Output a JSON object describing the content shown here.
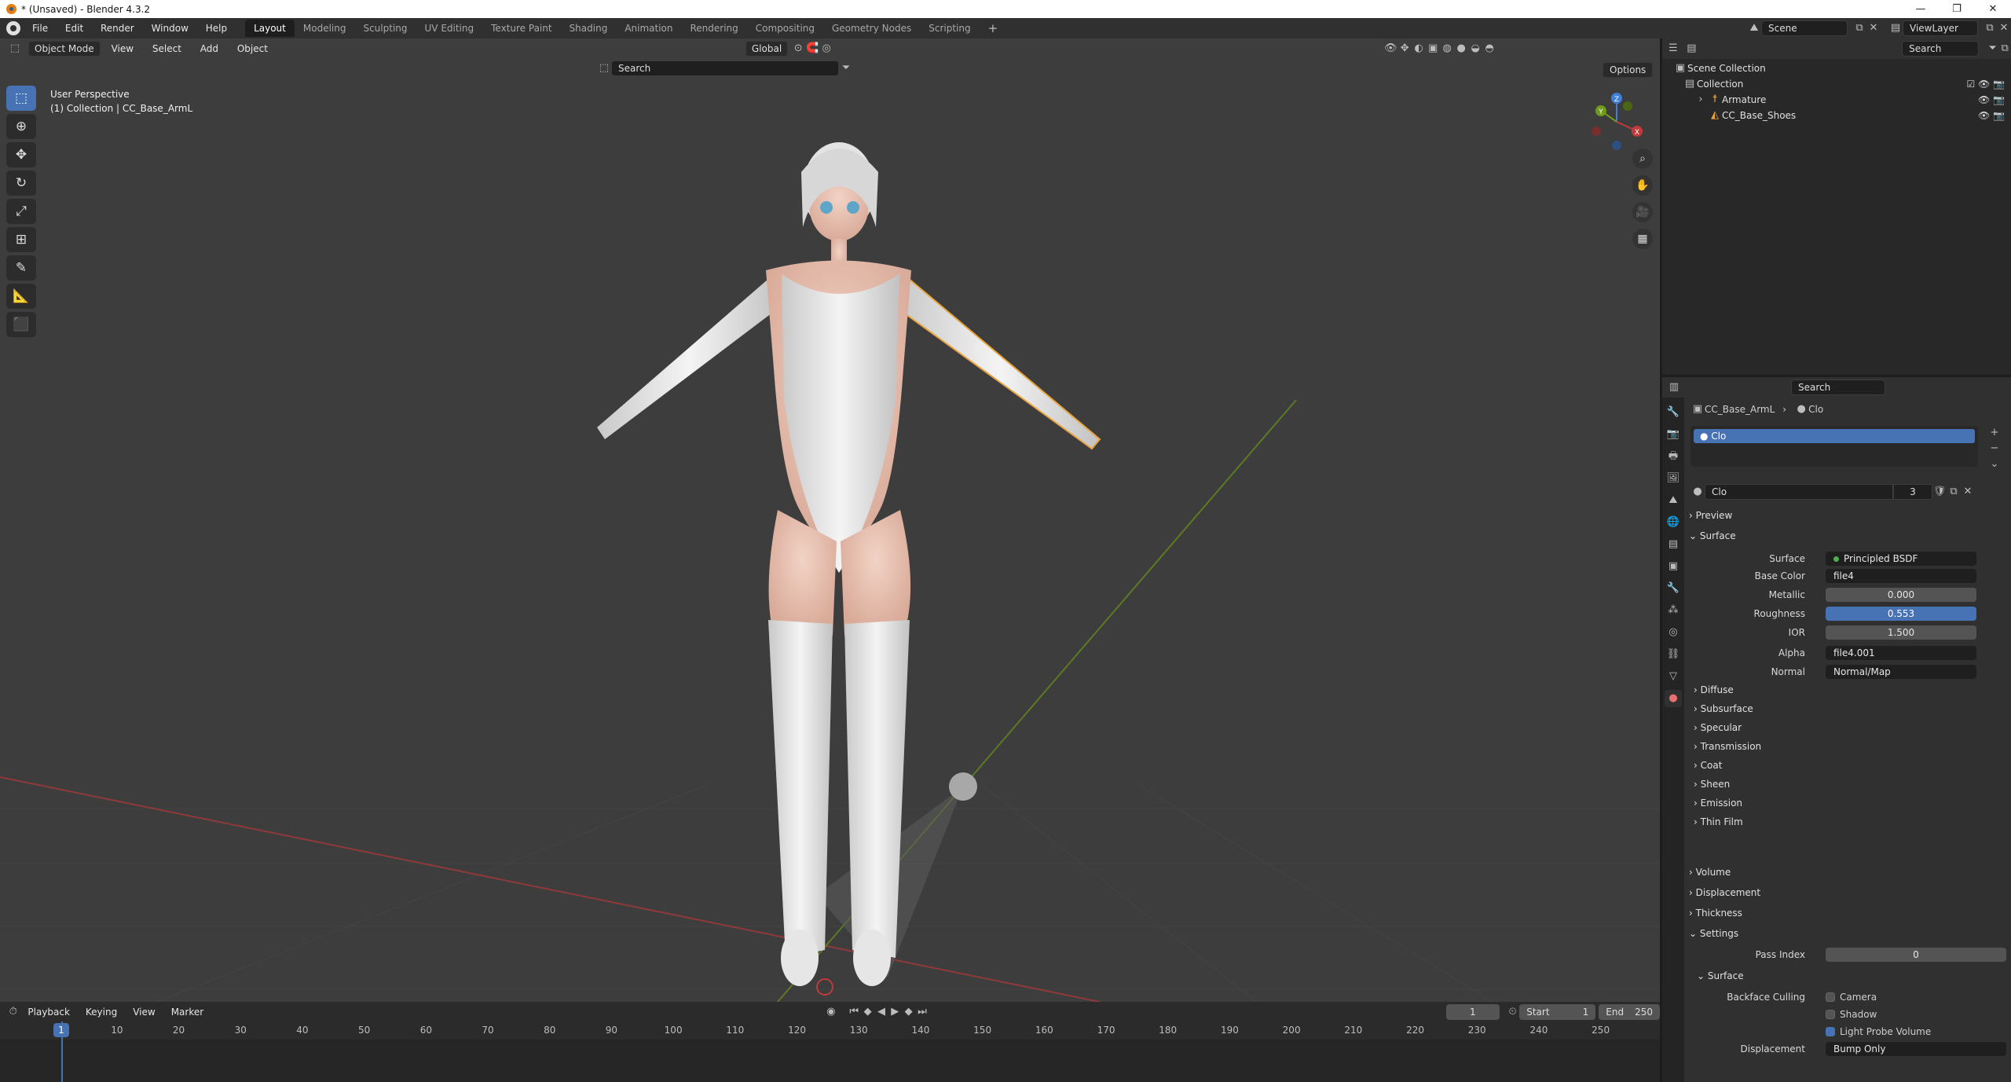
{
  "window": {
    "title": "* (Unsaved) - Blender 4.3.2",
    "controls": [
      "—",
      "❐",
      "✕"
    ]
  },
  "menu": [
    "File",
    "Edit",
    "Render",
    "Window",
    "Help"
  ],
  "workspaces": [
    "Layout",
    "Modeling",
    "Sculpting",
    "UV Editing",
    "Texture Paint",
    "Shading",
    "Animation",
    "Rendering",
    "Compositing",
    "Geometry Nodes",
    "Scripting"
  ],
  "active_workspace": "Layout",
  "scene": {
    "scene_name": "Scene",
    "view_layer": "ViewLayer"
  },
  "viewport": {
    "mode": "Object Mode",
    "menus": [
      "View",
      "Select",
      "Add",
      "Object"
    ],
    "orientation": "Global",
    "search_placeholder": "Search",
    "options_label": "Options",
    "perspective": "User Perspective",
    "context": "(1) Collection | CC_Base_ArmL",
    "gizmo_axes": {
      "x": "X",
      "y": "Y",
      "z": "Z"
    }
  },
  "timeline": {
    "menus": [
      "Playback",
      "Keying",
      "View",
      "Marker"
    ],
    "current_frame": "1",
    "start_label": "Start",
    "start": "1",
    "end_label": "End",
    "end": "250",
    "ruler": [
      "1",
      "10",
      "20",
      "30",
      "40",
      "50",
      "60",
      "70",
      "80",
      "90",
      "100",
      "110",
      "120",
      "130",
      "140",
      "150",
      "160",
      "170",
      "180",
      "190",
      "200",
      "210",
      "220",
      "230",
      "240",
      "250"
    ]
  },
  "outliner": {
    "search_placeholder": "Search",
    "rows": [
      "Scene Collection",
      "Collection",
      "Armature",
      "CC_Base_Shoes"
    ]
  },
  "properties": {
    "search_placeholder": "Search",
    "breadcrumb_object": "CC_Base_ArmL",
    "breadcrumb_material": "Clo",
    "slot_name": "Clo",
    "material_name": "Clo",
    "users": "3",
    "panels": {
      "preview": "Preview",
      "surface": "Surface"
    },
    "surface_shader_label": "Surface",
    "surface_shader": "Principled BSDF",
    "inputs": [
      {
        "label": "Base Color",
        "value": "file4",
        "kind": "link"
      },
      {
        "label": "Metallic",
        "value": "0.000",
        "kind": "num"
      },
      {
        "label": "Roughness",
        "value": "0.553",
        "kind": "num"
      },
      {
        "label": "IOR",
        "value": "1.500",
        "kind": "num"
      },
      {
        "label": "Alpha",
        "value": "file4.001",
        "kind": "link"
      },
      {
        "label": "Normal",
        "value": "Normal/Map",
        "kind": "link"
      }
    ],
    "subpanels": [
      "Diffuse",
      "Subsurface",
      "Specular",
      "Transmission",
      "Coat",
      "Sheen",
      "Emission",
      "Thin Film"
    ],
    "sections": [
      "Volume",
      "Displacement",
      "Thickness"
    ],
    "settings": {
      "title": "Settings",
      "pass_index_label": "Pass Index",
      "pass_index": "0",
      "surface_title": "Surface",
      "backface_label": "Backface Culling",
      "camera": "Camera",
      "shadow": "Shadow",
      "light_probe": "Light Probe Volume",
      "displacement_label": "Displacement",
      "displacement_value": "Bump Only"
    }
  },
  "colors": {
    "accent": "#4772b3",
    "selected_outline": "#e8a33d",
    "x_axis": "#c23a3a",
    "y_axis": "#6f9a1b"
  }
}
